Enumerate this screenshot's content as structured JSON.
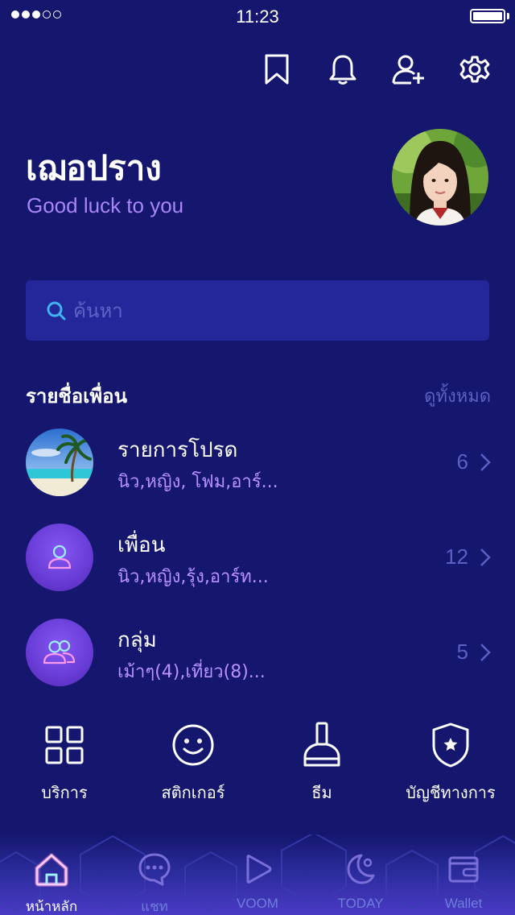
{
  "status_bar": {
    "time": "11:23"
  },
  "profile": {
    "name": "เฌอปราง",
    "status": "Good luck to you"
  },
  "search": {
    "placeholder": "ค้นหา"
  },
  "friends_section": {
    "title": "รายชื่อเพื่อน",
    "see_all": "ดูทั้งหมด",
    "rows": [
      {
        "title": "รายการโปรด",
        "subtitle": "นิว,หญิง, โฟม,อาร์...",
        "count": "6"
      },
      {
        "title": "เพื่อน",
        "subtitle": "นิว,หญิง,รุ้ง,อาร์ท...",
        "count": "12"
      },
      {
        "title": "กลุ่ม",
        "subtitle": "เม้าๆ(4),เที่ยว(8)...",
        "count": "5"
      }
    ]
  },
  "services": [
    {
      "label": "บริการ",
      "icon": "grid-icon"
    },
    {
      "label": "สติกเกอร์",
      "icon": "smiley-icon"
    },
    {
      "label": "ธีม",
      "icon": "brush-icon"
    },
    {
      "label": "บัญชีทางการ",
      "icon": "shield-star-icon"
    }
  ],
  "tabs": [
    {
      "label": "หน้าหลัก",
      "icon": "home-icon",
      "active": true
    },
    {
      "label": "แชท",
      "icon": "chat-icon"
    },
    {
      "label": "VOOM",
      "icon": "play-icon"
    },
    {
      "label": "TODAY",
      "icon": "moon-icon"
    },
    {
      "label": "Wallet",
      "icon": "wallet-icon"
    }
  ],
  "colors": {
    "background": "#15166e",
    "accent_purple": "#a886f8",
    "muted_blue": "#5c5fc3",
    "active_tab_glow": "#ff7ad9"
  }
}
